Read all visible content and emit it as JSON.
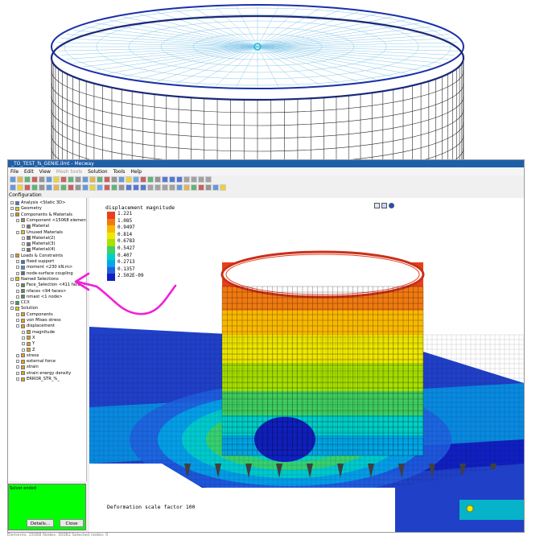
{
  "window": {
    "title": "_TO_TEST_fs_GENIE.ilmt - Mecway"
  },
  "menu": [
    "File",
    "Edit",
    "View",
    "Mesh tools",
    "Solution",
    "Tools",
    "Help"
  ],
  "panel": {
    "label": "Configuration"
  },
  "tree": [
    {
      "label": "Analysis <Static 3D>",
      "indent": 0,
      "icon": "#3a7bd5"
    },
    {
      "label": "Geometry",
      "indent": 0,
      "icon": "#e8c800"
    },
    {
      "label": "Components & Materials",
      "indent": 0,
      "icon": "#c89030"
    },
    {
      "label": "Component <15068 elements>",
      "indent": 1,
      "icon": "#8a8a8a"
    },
    {
      "label": "Material",
      "indent": 2,
      "icon": "#777777"
    },
    {
      "label": "Unused Materials",
      "indent": 1,
      "icon": "#e8c800"
    },
    {
      "label": "Material(2)",
      "indent": 2,
      "icon": "#777777"
    },
    {
      "label": "Material(3)",
      "indent": 2,
      "icon": "#777777"
    },
    {
      "label": "Material(4)",
      "indent": 2,
      "icon": "#777777"
    },
    {
      "label": "Loads & Constraints",
      "indent": 0,
      "icon": "#e09020"
    },
    {
      "label": "fixed support",
      "indent": 1,
      "icon": "#3a6fd0"
    },
    {
      "label": "moment <230 kN.m>",
      "indent": 1,
      "icon": "#4a90e2"
    },
    {
      "label": "node-surface coupling",
      "indent": 1,
      "icon": "#6a6a6a"
    },
    {
      "label": "Named Selections",
      "indent": 0,
      "icon": "#e8c800"
    },
    {
      "label": "Face_Selection <411 faces>",
      "indent": 1,
      "icon": "#5a8a5a"
    },
    {
      "label": "nfaces <94 faces>",
      "indent": 1,
      "icon": "#5a8a5a"
    },
    {
      "label": "nmast <1 node>",
      "indent": 1,
      "icon": "#5a8a5a"
    },
    {
      "label": "CCX",
      "indent": 0,
      "icon": "#30a050"
    },
    {
      "label": "Solution",
      "indent": 0,
      "icon": "#e8c800"
    },
    {
      "label": "Components",
      "indent": 1,
      "icon": "#e0a020"
    },
    {
      "label": "von Mises stress",
      "indent": 1,
      "icon": "#e0a020"
    },
    {
      "label": "displacement",
      "indent": 1,
      "icon": "#e0a020"
    },
    {
      "label": "magnitude",
      "indent": 2,
      "icon": "#e0a020"
    },
    {
      "label": "X",
      "indent": 2,
      "icon": "#e0a020"
    },
    {
      "label": "Y",
      "indent": 2,
      "icon": "#e0a020"
    },
    {
      "label": "Z",
      "indent": 2,
      "icon": "#e0a020"
    },
    {
      "label": "stress",
      "indent": 1,
      "icon": "#e0a020"
    },
    {
      "label": "external force",
      "indent": 1,
      "icon": "#e0a020"
    },
    {
      "label": "strain",
      "indent": 1,
      "icon": "#e0a020"
    },
    {
      "label": "strain energy density",
      "indent": 1,
      "icon": "#e0a020"
    },
    {
      "label": "ERROR_STR_%_",
      "indent": 1,
      "icon": "#e0a020"
    }
  ],
  "solver": {
    "message": "Solver ended",
    "details_label": "Details...",
    "close_label": "Close"
  },
  "legend": {
    "title": "displacement magnitude",
    "values": [
      "1.221",
      "1.085",
      "0.9497",
      "0.814",
      "0.6783",
      "0.5427",
      "0.407",
      "0.2713",
      "0.1357",
      "2.502E-09"
    ],
    "colors": [
      "#e8401a",
      "#f07a10",
      "#f8b800",
      "#f0e800",
      "#a8e000",
      "#40d060",
      "#00d0c8",
      "#00a8e8",
      "#2060e0",
      "#1020c0"
    ]
  },
  "viewport": {
    "deformation_label": "Deformation scale factor 100"
  },
  "status": {
    "text": "Elements: 15068    Nodes: 30082    Selected nodes: 0"
  }
}
